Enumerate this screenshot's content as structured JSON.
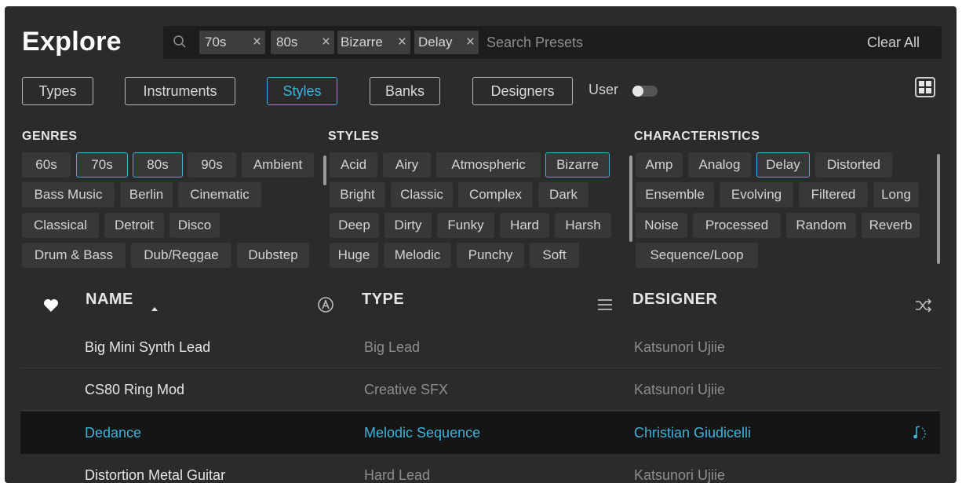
{
  "header": {
    "title": "Explore"
  },
  "search": {
    "placeholder": "Search Presets",
    "clear_label": "Clear All",
    "chips": [
      "70s",
      "80s",
      "Bizarre",
      "Delay"
    ]
  },
  "filters": {
    "tabs": [
      "Types",
      "Instruments",
      "Styles",
      "Banks",
      "Designers"
    ],
    "active_tab": "Styles",
    "user_label": "User",
    "user_toggle_on": false
  },
  "genres": {
    "heading": "GENRES",
    "tags": [
      "60s",
      "70s",
      "80s",
      "90s",
      "Ambient",
      "Bass Music",
      "Berlin",
      "Cinematic",
      "Classical",
      "Detroit",
      "Disco",
      "Drum & Bass",
      "Dub/Reggae",
      "Dubstep"
    ],
    "selected": [
      "70s",
      "80s"
    ]
  },
  "styles": {
    "heading": "STYLES",
    "tags": [
      "Acid",
      "Airy",
      "Atmospheric",
      "Bizarre",
      "Bright",
      "Classic",
      "Complex",
      "Dark",
      "Deep",
      "Dirty",
      "Funky",
      "Hard",
      "Harsh",
      "Huge",
      "Melodic",
      "Punchy",
      "Soft"
    ],
    "selected": [
      "Bizarre"
    ]
  },
  "characteristics": {
    "heading": "CHARACTERISTICS",
    "tags": [
      "Amp",
      "Analog",
      "Delay",
      "Distorted",
      "Ensemble",
      "Evolving",
      "Filtered",
      "Long",
      "Noise",
      "Processed",
      "Random",
      "Reverb",
      "Sequence/Loop"
    ],
    "selected": [
      "Delay"
    ]
  },
  "list": {
    "columns": {
      "name": "NAME",
      "type": "TYPE",
      "designer": "DESIGNER"
    },
    "rows": [
      {
        "name": "Big Mini Synth Lead",
        "type": "Big Lead",
        "designer": "Katsunori Ujiie"
      },
      {
        "name": "CS80 Ring Mod",
        "type": "Creative SFX",
        "designer": "Katsunori Ujiie"
      },
      {
        "name": "Dedance",
        "type": "Melodic Sequence",
        "designer": "Christian Giudicelli"
      },
      {
        "name": "Distortion Metal Guitar",
        "type": "Hard Lead",
        "designer": "Katsunori Ujiie"
      }
    ],
    "selected_row": "Dedance"
  },
  "colors": {
    "accent": "#3db2dc",
    "background": "#2b2b2b",
    "panel": "#1d1d1d",
    "tag": "#383838"
  },
  "icons": [
    "search-icon",
    "close-icon",
    "grid-view-icon",
    "heart-icon",
    "sort-up-icon",
    "arturia-logo-icon",
    "list-icon",
    "shuffle-icon",
    "note-icon"
  ]
}
